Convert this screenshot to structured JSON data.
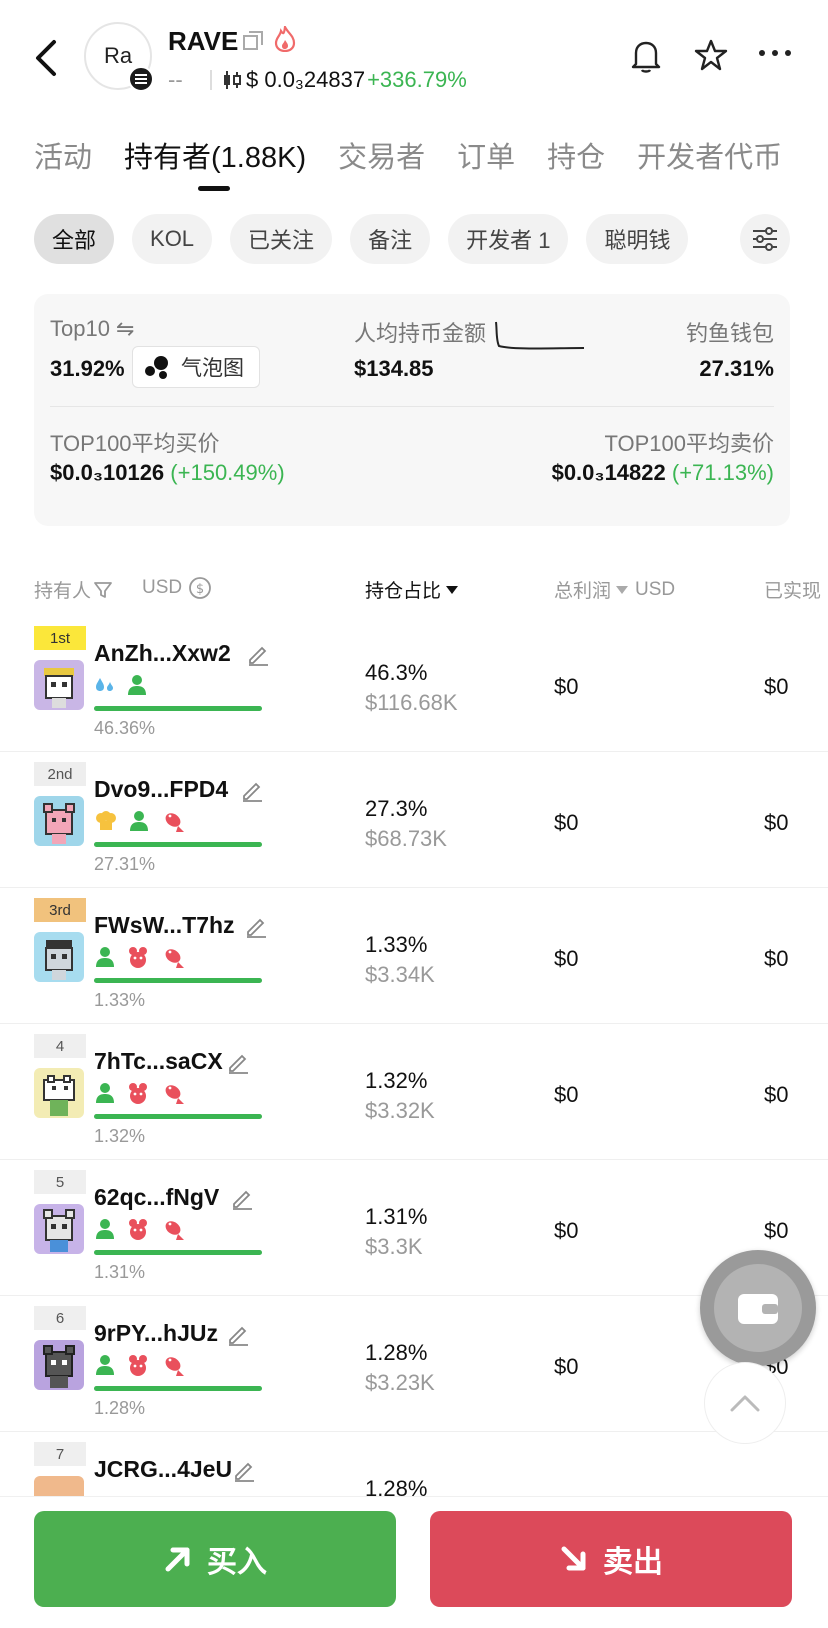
{
  "header": {
    "avatar_text": "Ra",
    "token_name": "RAVE",
    "dashes": "--",
    "price": "$ 0.0₃24837",
    "change": "+336.79%"
  },
  "tabs": [
    {
      "label": "活动"
    },
    {
      "label": "持有者(1.88K)"
    },
    {
      "label": "交易者"
    },
    {
      "label": "订单"
    },
    {
      "label": "持仓"
    },
    {
      "label": "开发者代币"
    }
  ],
  "chips": [
    {
      "label": "全部"
    },
    {
      "label": "KOL"
    },
    {
      "label": "已关注"
    },
    {
      "label": "备注"
    },
    {
      "label": "开发者 1"
    },
    {
      "label": "聪明钱"
    }
  ],
  "stats": {
    "top10_label": "Top10 ⇋",
    "top10_value": "31.92%",
    "bubble_label": "气泡图",
    "avg_label": "人均持币金额",
    "avg_value": "$134.85",
    "phish_label": "钓鱼钱包",
    "phish_value": "27.31%",
    "buy_label": "TOP100平均买价",
    "buy_value": "$0.0₃10126",
    "buy_change": "(+150.49%)",
    "sell_label": "TOP100平均卖价",
    "sell_value": "$0.0₃14822",
    "sell_change": "(+71.13%)"
  },
  "table_header": {
    "holder": "持有人",
    "usd": "USD",
    "share": "持仓占比",
    "profit": "总利润",
    "profit_unit": "USD",
    "realized": "已实现"
  },
  "rows": [
    {
      "rank": "1st",
      "address": "AnZh...Xxw2",
      "small_pct": "46.36%",
      "pct": "46.3%",
      "usd": "$116.68K",
      "profit": "$0",
      "realized": "$0"
    },
    {
      "rank": "2nd",
      "address": "Dvo9...FPD4",
      "small_pct": "27.31%",
      "pct": "27.3%",
      "usd": "$68.73K",
      "profit": "$0",
      "realized": "$0"
    },
    {
      "rank": "3rd",
      "address": "FWsW...T7hz",
      "small_pct": "1.33%",
      "pct": "1.33%",
      "usd": "$3.34K",
      "profit": "$0",
      "realized": "$0"
    },
    {
      "rank": "4",
      "address": "7hTc...saCX",
      "small_pct": "1.32%",
      "pct": "1.32%",
      "usd": "$3.32K",
      "profit": "$0",
      "realized": "$0"
    },
    {
      "rank": "5",
      "address": "62qc...fNgV",
      "small_pct": "1.31%",
      "pct": "1.31%",
      "usd": "$3.3K",
      "profit": "$0",
      "realized": "$0"
    },
    {
      "rank": "6",
      "address": "9rPY...hJUz",
      "small_pct": "1.28%",
      "pct": "1.28%",
      "usd": "$3.23K",
      "profit": "$0",
      "realized": "$0"
    },
    {
      "rank": "7",
      "address": "JCRG...4JeU",
      "small_pct": "",
      "pct": "1.28%",
      "usd": "",
      "profit": "",
      "realized": ""
    }
  ],
  "actions": {
    "buy": "买入",
    "sell": "卖出"
  },
  "colors": {
    "green": "#3bb552",
    "buy_button": "#4caf50",
    "sell_button": "#dc4a5a",
    "rank1": "#fbe73a",
    "rank3": "#f1c27d"
  }
}
